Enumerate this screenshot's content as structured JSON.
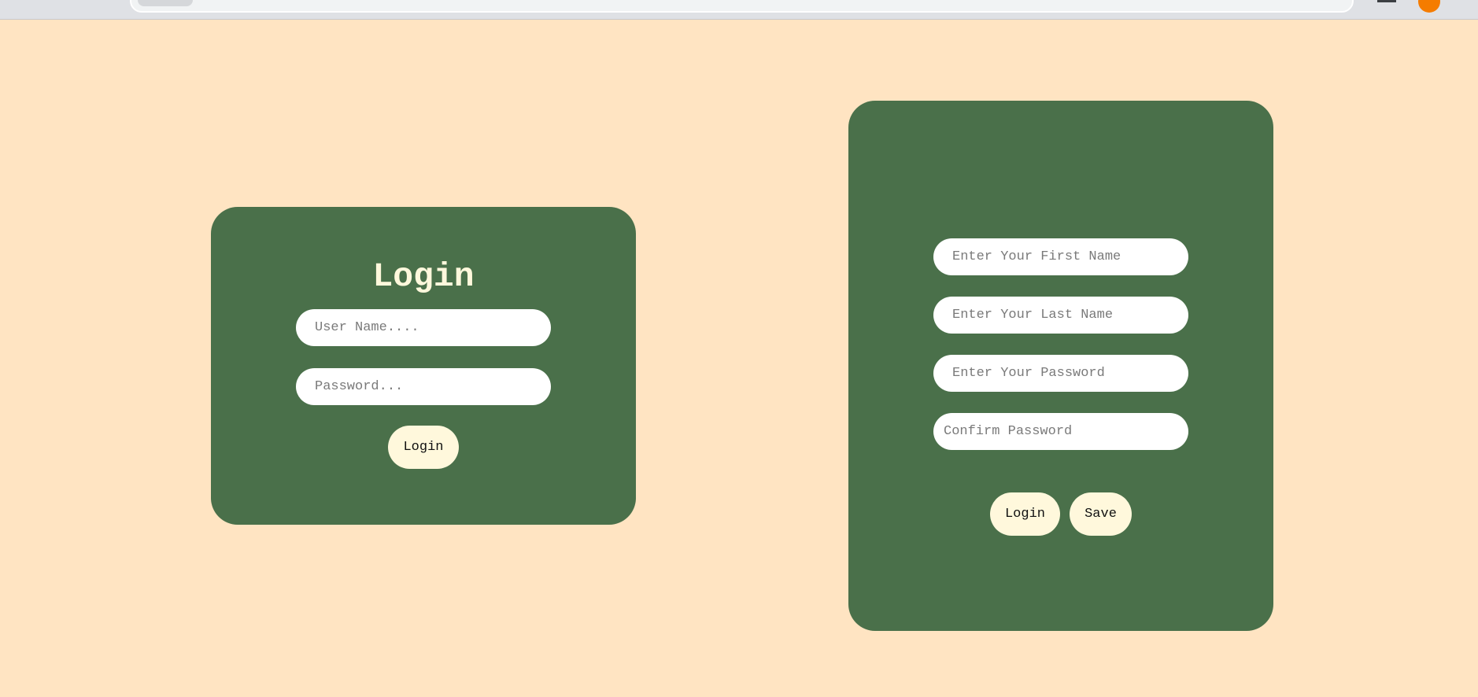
{
  "login_form": {
    "title": "Login",
    "username_placeholder": "User Name....",
    "password_placeholder": "Password...",
    "submit_label": "Login"
  },
  "register_form": {
    "first_name_placeholder": "Enter Your First Name",
    "last_name_placeholder": "Enter Your Last Name",
    "password_placeholder": "Enter Your Password",
    "confirm_password_placeholder": "Confirm Password",
    "login_label": "Login",
    "save_label": "Save"
  },
  "colors": {
    "page_background": "#ffe4c2",
    "card_background": "#4a704a",
    "title_text": "#fff8dc",
    "button_background": "#fff8dc",
    "input_background": "#ffffff"
  }
}
